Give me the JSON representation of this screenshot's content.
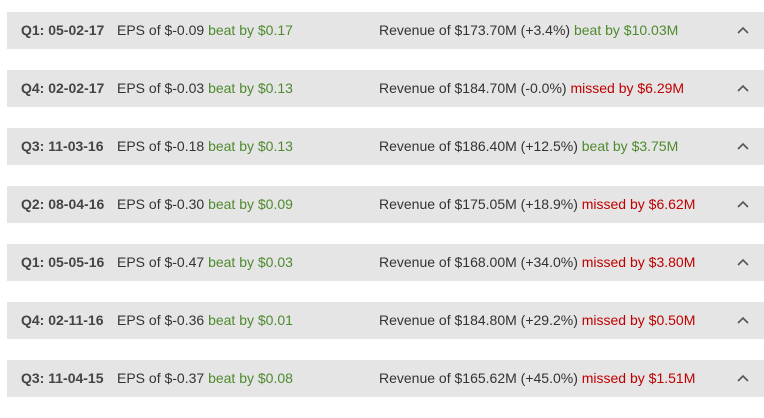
{
  "colors": {
    "beat": "#4f8a2f",
    "missed": "#c00000",
    "row_background": "#e5e5e5"
  },
  "icons": {
    "expand_toggle": "chevron-up-icon"
  },
  "rows": [
    {
      "quarter": "Q1: 05-02-17",
      "eps_prefix": "EPS of $-0.09",
      "eps_result": "beat by $0.17",
      "eps_status": "beat",
      "revenue_prefix": "Revenue of $173.70M (+3.4%)",
      "revenue_result": "beat by $10.03M",
      "revenue_status": "beat"
    },
    {
      "quarter": "Q4: 02-02-17",
      "eps_prefix": "EPS of $-0.03",
      "eps_result": "beat by $0.13",
      "eps_status": "beat",
      "revenue_prefix": "Revenue of $184.70M (-0.0%)",
      "revenue_result": "missed by $6.29M",
      "revenue_status": "missed"
    },
    {
      "quarter": "Q3: 11-03-16",
      "eps_prefix": "EPS of $-0.18",
      "eps_result": "beat by $0.13",
      "eps_status": "beat",
      "revenue_prefix": "Revenue of $186.40M (+12.5%)",
      "revenue_result": "beat by $3.75M",
      "revenue_status": "beat"
    },
    {
      "quarter": "Q2: 08-04-16",
      "eps_prefix": "EPS of $-0.30",
      "eps_result": "beat by $0.09",
      "eps_status": "beat",
      "revenue_prefix": "Revenue of $175.05M (+18.9%)",
      "revenue_result": "missed by $6.62M",
      "revenue_status": "missed"
    },
    {
      "quarter": "Q1: 05-05-16",
      "eps_prefix": "EPS of $-0.47",
      "eps_result": "beat by $0.03",
      "eps_status": "beat",
      "revenue_prefix": "Revenue of $168.00M (+34.0%)",
      "revenue_result": "missed by $3.80M",
      "revenue_status": "missed"
    },
    {
      "quarter": "Q4: 02-11-16",
      "eps_prefix": "EPS of $-0.36",
      "eps_result": "beat by $0.01",
      "eps_status": "beat",
      "revenue_prefix": "Revenue of $184.80M (+29.2%)",
      "revenue_result": "missed by $0.50M",
      "revenue_status": "missed"
    },
    {
      "quarter": "Q3: 11-04-15",
      "eps_prefix": "EPS of $-0.37",
      "eps_result": "beat by $0.08",
      "eps_status": "beat",
      "revenue_prefix": "Revenue of $165.62M (+45.0%)",
      "revenue_result": "missed by $1.51M",
      "revenue_status": "missed"
    }
  ]
}
